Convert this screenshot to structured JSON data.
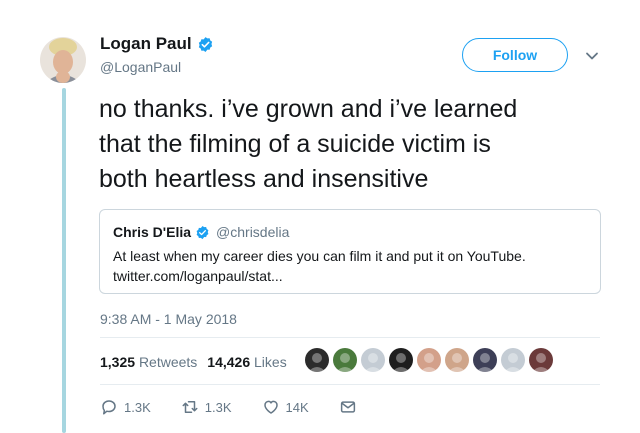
{
  "author": {
    "name": "Logan Paul",
    "handle": "@LoganPaul",
    "verified": true,
    "avatar": "avatar"
  },
  "follow_button": {
    "label": "Follow"
  },
  "menu_icon": "chevron-down-icon",
  "tweet": {
    "text_line1": "no thanks. i’ve grown and i’ve learned",
    "text_line2": "that the filming of a suicide victim is",
    "text_line3": "both heartless and insensitive"
  },
  "quoted_tweet": {
    "name": "Chris D'Elia",
    "handle": "@chrisdelia",
    "verified": true,
    "text": "At least when my career dies you can film it and put it on YouTube.",
    "link": "twitter.com/loganpaul/stat..."
  },
  "timestamp": "9:38 AM - 1 May 2018",
  "stats": {
    "retweets_count": "1,325",
    "retweets_label": "Retweets",
    "likes_count": "14,426",
    "likes_label": "Likes"
  },
  "likers": [
    {
      "color": "#2b2b2b"
    },
    {
      "color": "#4a7a3c"
    },
    {
      "color": "#c4ccd4"
    },
    {
      "color": "#1e1e1e"
    },
    {
      "color": "#d3a08a"
    },
    {
      "color": "#cfa58a"
    },
    {
      "color": "#3d3f57"
    },
    {
      "color": "#c4ccd4"
    },
    {
      "color": "#6b3a3a"
    }
  ],
  "actions": {
    "reply_count": "1.3K",
    "retweet_count": "1.3K",
    "like_count": "14K"
  },
  "colors": {
    "accent": "#1da1f2",
    "thread_line": "#a6d6e0",
    "secondary_text": "#657786",
    "border": "#ccd6dd"
  }
}
